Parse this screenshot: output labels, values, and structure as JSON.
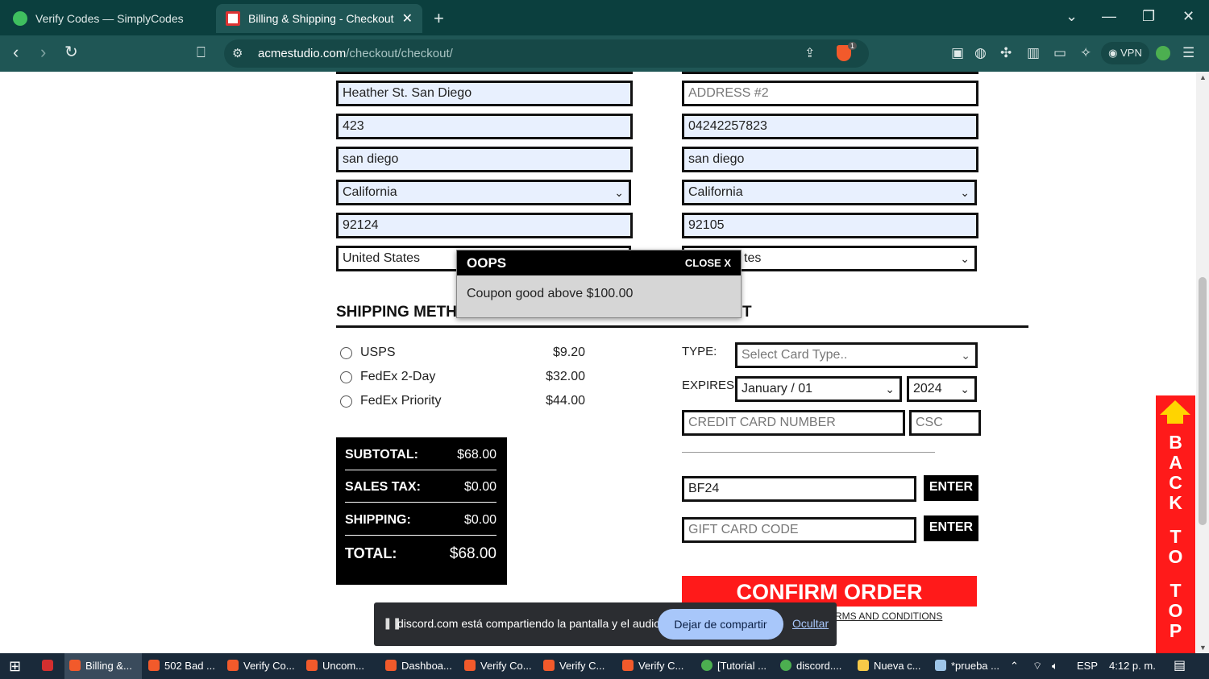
{
  "browser": {
    "tabs": [
      {
        "title": "Verify Codes — SimplyCodes",
        "active": false
      },
      {
        "title": "Billing & Shipping - Checkout S",
        "active": true
      }
    ],
    "new_tab": "+",
    "url_host": "acmestudio.com",
    "url_path": "/checkout/checkout/",
    "vpn_label": "VPN",
    "badge": "1"
  },
  "billing": {
    "address1": "Heather St. San Diego",
    "address2": "423",
    "city": "san diego",
    "state": "California",
    "zip": "92124",
    "country": "United States"
  },
  "shipping_addr": {
    "address2_placeholder": "ADDRESS #2",
    "phone": "04242257823",
    "city": "san diego",
    "state": "California",
    "zip": "92105",
    "country_visible": "tes"
  },
  "popup": {
    "title": "OOPS",
    "close_label": "CLOSE X",
    "message": "Coupon good above $100.00"
  },
  "shipping_method": {
    "title": "SHIPPING METHO",
    "options": [
      {
        "name": "USPS",
        "price": "$9.20"
      },
      {
        "name": "FedEx 2-Day",
        "price": "$32.00"
      },
      {
        "name": "FedEx Priority",
        "price": "$44.00"
      }
    ]
  },
  "payment": {
    "title_tail": "T",
    "type_label": "TYPE:",
    "type_value": "Select Card Type..",
    "expires_label": "EXPIRES:",
    "month": "January / 01",
    "year": "2024",
    "card_placeholder": "CREDIT CARD NUMBER",
    "csc_placeholder": "CSC",
    "coupon_value": "BF24",
    "enter_label": "ENTER",
    "gift_placeholder": "GIFT CARD CODE",
    "confirm_label": "CONFIRM ORDER",
    "terms_text": "RMS AND CONDITIONS"
  },
  "totals": {
    "subtotal_label": "SUBTOTAL:",
    "subtotal": "$68.00",
    "tax_label": "SALES TAX:",
    "tax": "$0.00",
    "shipping_label": "SHIPPING:",
    "shipping": "$0.00",
    "total_label": "TOTAL:",
    "total": "$68.00"
  },
  "back_to_top": [
    "B",
    "A",
    "C",
    "K",
    "",
    "T",
    "O",
    "",
    "T",
    "O",
    "P"
  ],
  "share_bar": {
    "message": "discord.com está compartiendo la pantalla y el audio.",
    "stop_label": "Dejar de compartir",
    "hide_label": "Ocultar"
  },
  "taskbar": {
    "items": [
      "Billing &...",
      "502 Bad ...",
      "Verify Co...",
      "Uncom...",
      "Dashboa...",
      "Verify Co...",
      "Verify C...",
      "Verify C...",
      "[Tutorial ...",
      "discord....",
      "Nueva c...",
      "*prueba ..."
    ],
    "lang": "ESP",
    "time": "4:12 p. m."
  },
  "colors": {
    "browser_bg": "#0b3f3e",
    "toolbar_bg": "#1f5655",
    "accent_red": "#ff1a1a",
    "autofill_bg": "#e8f0fe"
  }
}
